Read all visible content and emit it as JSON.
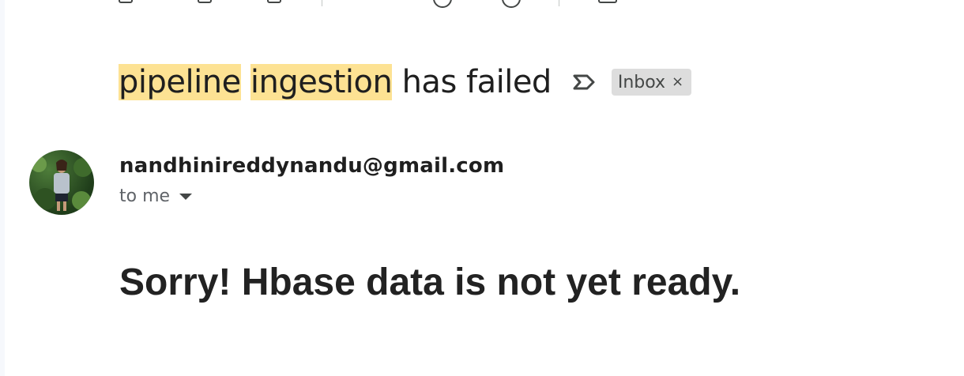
{
  "email": {
    "subject": {
      "highlight_1": "pipeline",
      "highlight_2": "ingestion",
      "rest": "has failed"
    },
    "important_icon": "important-marker-icon",
    "label_chip": {
      "label": "Inbox",
      "close_glyph": "×"
    },
    "sender": {
      "email": "nandhinireddynandu@gmail.com",
      "recipient": "to me"
    },
    "body": {
      "text": "Sorry! Hbase data is not yet ready."
    }
  },
  "colors": {
    "highlight": "#fde293",
    "chip_bg": "#dddddd",
    "text_primary": "#1f1f1f",
    "text_secondary": "#5f6368"
  }
}
